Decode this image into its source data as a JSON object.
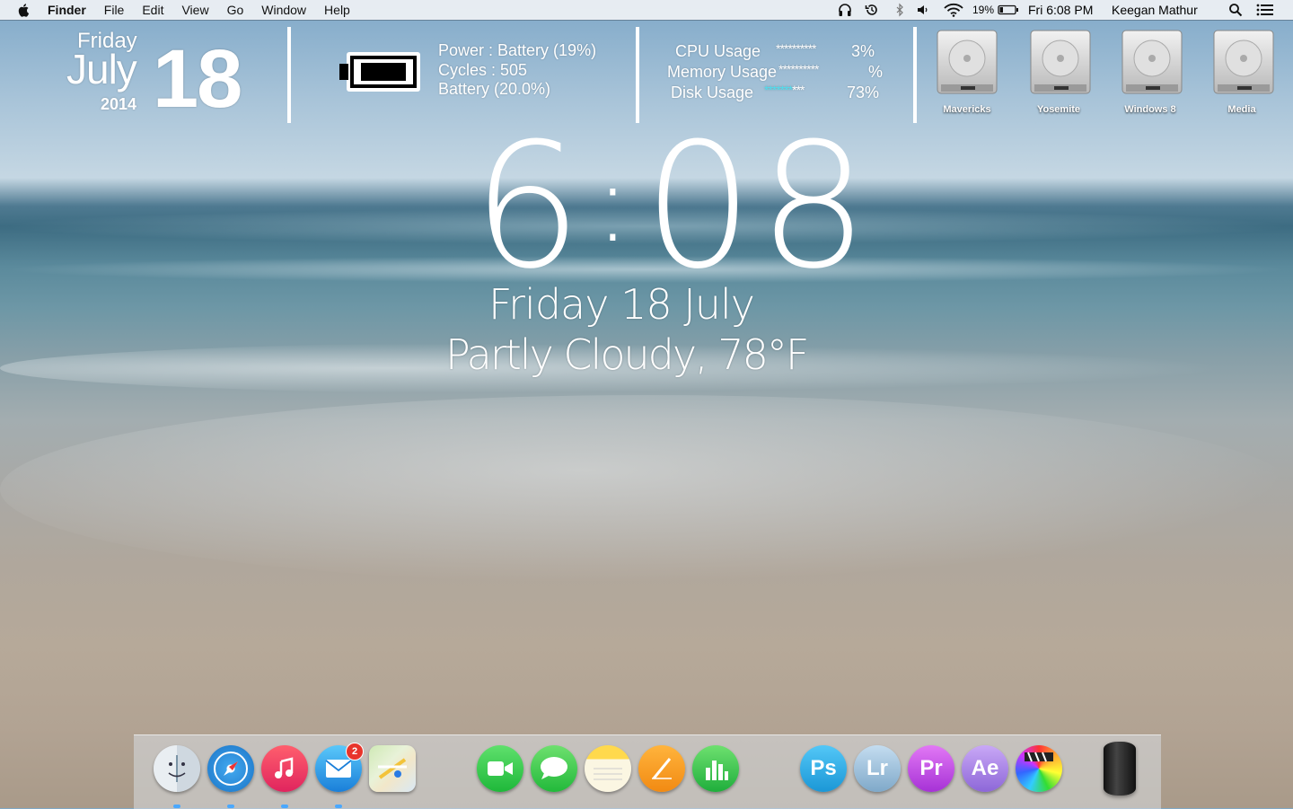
{
  "menubar": {
    "app_name": "Finder",
    "menus": [
      "File",
      "Edit",
      "View",
      "Go",
      "Window",
      "Help"
    ],
    "battery_percent": "19%",
    "clock": "Fri 6:08 PM",
    "user_name": "Keegan Mathur",
    "icons": [
      "apple-icon",
      "headphones-icon",
      "time-machine-icon",
      "bluetooth-icon",
      "volume-icon",
      "wifi-icon",
      "battery-icon",
      "spotlight-icon",
      "notification-center-icon"
    ]
  },
  "date_widget": {
    "weekday": "Friday",
    "month": "July",
    "year": "2014",
    "day": "18"
  },
  "battery_widget": {
    "power": "Power : Battery (19%)",
    "cycles": "Cycles : 505",
    "battery": "Battery (20.0%)",
    "level": 0.19
  },
  "system_widget": {
    "cpu_label": "CPU Usage",
    "cpu_bar": "**********",
    "cpu_value": "3%",
    "memory_label": "Memory Usage",
    "memory_bar": "**********",
    "memory_value": "%",
    "disk_label": "Disk Usage",
    "disk_bar_used": "*******",
    "disk_bar_free": "***",
    "disk_value": "73%",
    "disk_bar_color": "#4fe0f0"
  },
  "drives": [
    {
      "name": "Mavericks"
    },
    {
      "name": "Yosemite"
    },
    {
      "name": "Windows 8"
    },
    {
      "name": "Media"
    }
  ],
  "clock_widget": {
    "hour": "6",
    "minutes": "08",
    "date_line": "Friday 18 July",
    "weather_line": "Partly Cloudy, 78°F"
  },
  "dock": {
    "mail_badge": "2",
    "photoshop_label": "Ps",
    "lightroom_label": "Lr",
    "premiere_label": "Pr",
    "aftereffects_label": "Ae",
    "apps": [
      "finder-icon",
      "safari-icon",
      "itunes-icon",
      "mail-icon",
      "maps-icon",
      "facetime-icon",
      "messages-icon",
      "notes-icon",
      "pages-icon",
      "numbers-icon",
      "photoshop-icon",
      "lightroom-icon",
      "premiere-icon",
      "aftereffects-icon",
      "final-cut-icon",
      "mac-pro-icon"
    ]
  }
}
